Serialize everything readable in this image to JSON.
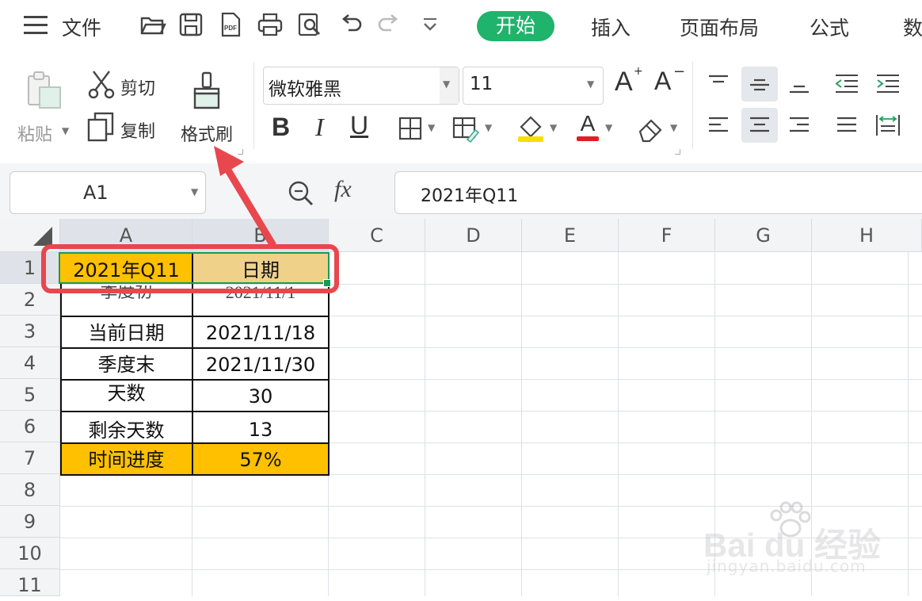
{
  "menu": {
    "file": "文件",
    "tabs": [
      "开始",
      "插入",
      "页面布局",
      "公式",
      "数"
    ],
    "active_tab_color": "#1fb36b"
  },
  "ribbon": {
    "paste": "粘贴",
    "cut": "剪切",
    "copy": "复制",
    "format_painter": "格式刷",
    "font_name": "微软雅黑",
    "font_size": "11",
    "bold": "B",
    "italic": "I",
    "underline": "U",
    "grow_font": "A",
    "shrink_font": "A",
    "font_color_letter": "A",
    "fill_color": "#f5e000",
    "font_color": "#e02020"
  },
  "formula_bar": {
    "name_box": "A1",
    "fx": "fx",
    "content": "2021年Q11"
  },
  "sheet": {
    "columns": [
      "A",
      "B",
      "C",
      "D",
      "E",
      "F",
      "G",
      "H"
    ],
    "rows": [
      "1",
      "2",
      "3",
      "4",
      "5",
      "6",
      "7",
      "8",
      "9",
      "10",
      "11"
    ],
    "cells": [
      [
        "2021年Q11",
        "日期"
      ],
      [
        "季度初",
        "2021/11/1"
      ],
      [
        "当前日期",
        "2021/11/18"
      ],
      [
        "季度末",
        "2021/11/30"
      ],
      [
        "天数",
        "30"
      ],
      [
        "剩余天数",
        "13"
      ],
      [
        "时间进度",
        "57%"
      ]
    ],
    "orange_fill": "#ffc000",
    "tan_fill": "#efd18a"
  },
  "annotation": {
    "color": "#e8474e"
  },
  "watermark": {
    "brand": "Bai du 经验",
    "url": "jingyan.baidu.com"
  }
}
